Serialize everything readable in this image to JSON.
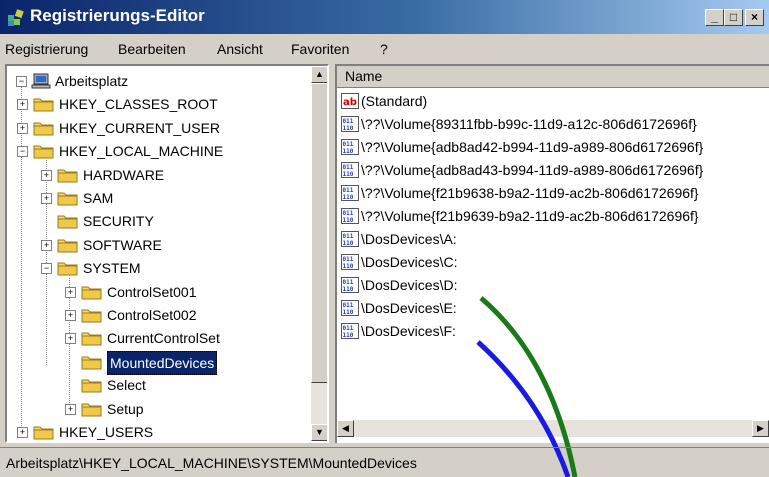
{
  "window": {
    "title": "Registrierungs-Editor",
    "minimize": "_",
    "maximize": "□",
    "close": "×"
  },
  "menu": [
    "Registrierung",
    "Bearbeiten",
    "Ansicht",
    "Favoriten",
    "?"
  ],
  "tree": {
    "root": "Arbeitsplatz",
    "items": [
      {
        "label": "HKEY_CLASSES_ROOT",
        "level": 1,
        "expander": "+"
      },
      {
        "label": "HKEY_CURRENT_USER",
        "level": 1,
        "expander": "+"
      },
      {
        "label": "HKEY_LOCAL_MACHINE",
        "level": 1,
        "expander": "−"
      },
      {
        "label": "HARDWARE",
        "level": 2,
        "expander": "+"
      },
      {
        "label": "SAM",
        "level": 2,
        "expander": "+"
      },
      {
        "label": "SECURITY",
        "level": 2,
        "expander": ""
      },
      {
        "label": "SOFTWARE",
        "level": 2,
        "expander": "+"
      },
      {
        "label": "SYSTEM",
        "level": 2,
        "expander": "−"
      },
      {
        "label": "ControlSet001",
        "level": 3,
        "expander": "+"
      },
      {
        "label": "ControlSet002",
        "level": 3,
        "expander": "+"
      },
      {
        "label": "CurrentControlSet",
        "level": 3,
        "expander": "+"
      },
      {
        "label": "MountedDevices",
        "level": 3,
        "expander": "",
        "selected": true
      },
      {
        "label": "Select",
        "level": 3,
        "expander": ""
      },
      {
        "label": "Setup",
        "level": 3,
        "expander": "+"
      },
      {
        "label": "HKEY_USERS",
        "level": 1,
        "expander": "+"
      }
    ]
  },
  "list": {
    "column_name": "Name",
    "rows": [
      {
        "name": "(Standard)",
        "icon": "string-value-icon"
      },
      {
        "name": "\\??\\Volume{89311fbb-b99c-11d9-a12c-806d6172696f}",
        "icon": "binary-value-icon"
      },
      {
        "name": "\\??\\Volume{adb8ad42-b994-11d9-a989-806d6172696f}",
        "icon": "binary-value-icon"
      },
      {
        "name": "\\??\\Volume{adb8ad43-b994-11d9-a989-806d6172696f}",
        "icon": "binary-value-icon"
      },
      {
        "name": "\\??\\Volume{f21b9638-b9a2-11d9-ac2b-806d6172696f}",
        "icon": "binary-value-icon"
      },
      {
        "name": "\\??\\Volume{f21b9639-b9a2-11d9-ac2b-806d6172696f}",
        "icon": "binary-value-icon"
      },
      {
        "name": "\\DosDevices\\A:",
        "icon": "binary-value-icon"
      },
      {
        "name": "\\DosDevices\\C:",
        "icon": "binary-value-icon"
      },
      {
        "name": "\\DosDevices\\D:",
        "icon": "binary-value-icon"
      },
      {
        "name": "\\DosDevices\\E:",
        "icon": "binary-value-icon"
      },
      {
        "name": "\\DosDevices\\F:",
        "icon": "binary-value-icon"
      }
    ]
  },
  "status": "Arbeitsplatz\\HKEY_LOCAL_MACHINE\\SYSTEM\\MountedDevices",
  "annotation_colors": {
    "green": "#1a7a1a",
    "blue": "#1a1ae0"
  }
}
